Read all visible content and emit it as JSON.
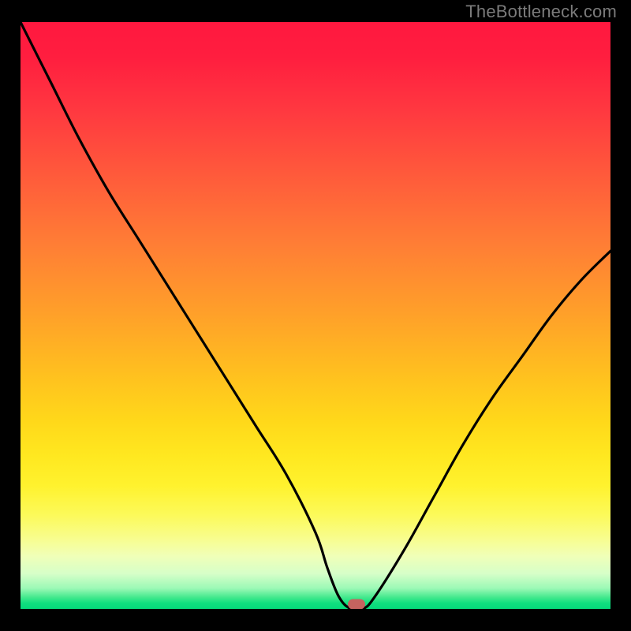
{
  "watermark": "TheBottleneck.com",
  "colors": {
    "frame": "#000000",
    "curve": "#000000",
    "marker": "#c5635f",
    "watermark": "#7b7b7b"
  },
  "chart_data": {
    "type": "line",
    "title": "",
    "xlabel": "",
    "ylabel": "",
    "xlim": [
      0,
      100
    ],
    "ylim": [
      0,
      100
    ],
    "grid": false,
    "legend": null,
    "series": [
      {
        "name": "bottleneck-curve",
        "x": [
          0,
          5,
          10,
          15,
          20,
          25,
          30,
          35,
          40,
          45,
          50,
          52,
          54,
          56,
          58,
          60,
          65,
          70,
          75,
          80,
          85,
          90,
          95,
          100
        ],
        "values": [
          100,
          90,
          80,
          71,
          63,
          55,
          47,
          39,
          31,
          23,
          13,
          7,
          2,
          0,
          0,
          2,
          10,
          19,
          28,
          36,
          43,
          50,
          56,
          61
        ]
      }
    ],
    "annotations": [
      {
        "name": "optimal-marker",
        "x": 57,
        "y": 0
      }
    ],
    "background": {
      "type": "vertical-gradient",
      "stops": [
        {
          "pos": 0.0,
          "color": "#ff183f"
        },
        {
          "pos": 0.5,
          "color": "#ffa129"
        },
        {
          "pos": 0.8,
          "color": "#fff22e"
        },
        {
          "pos": 1.0,
          "color": "#06d97a"
        }
      ]
    }
  }
}
